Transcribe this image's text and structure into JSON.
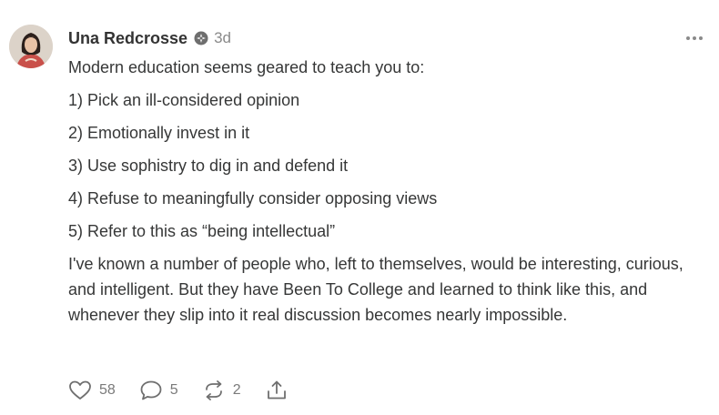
{
  "author": {
    "name": "Una Redcrosse",
    "timestamp": "3d"
  },
  "post": {
    "intro": "Modern education seems geared to teach you to:",
    "list": [
      "1) Pick an ill-considered opinion",
      "2) Emotionally invest in it",
      "3) Use sophistry to dig in and defend it",
      "4) Refuse to meaningfully consider opposing views",
      "5) Refer to this as “being intellectual”"
    ],
    "closing": "I've known a number of people who, left to themselves, would be interesting, curious, and intelligent. But they have Been To College and learned to think like this, and whenever they slip into it real discussion becomes nearly impossible."
  },
  "actions": {
    "likes": "58",
    "comments": "5",
    "restacks": "2"
  },
  "icons": {
    "badge": "badge-icon",
    "more": "more-options-icon",
    "like": "heart-icon",
    "comment": "comment-bubble-icon",
    "restack": "restack-arrows-icon",
    "share": "share-upload-icon"
  },
  "colors": {
    "text": "#363737",
    "muted": "#8a8a8a",
    "icon": "#6f6f6f"
  }
}
